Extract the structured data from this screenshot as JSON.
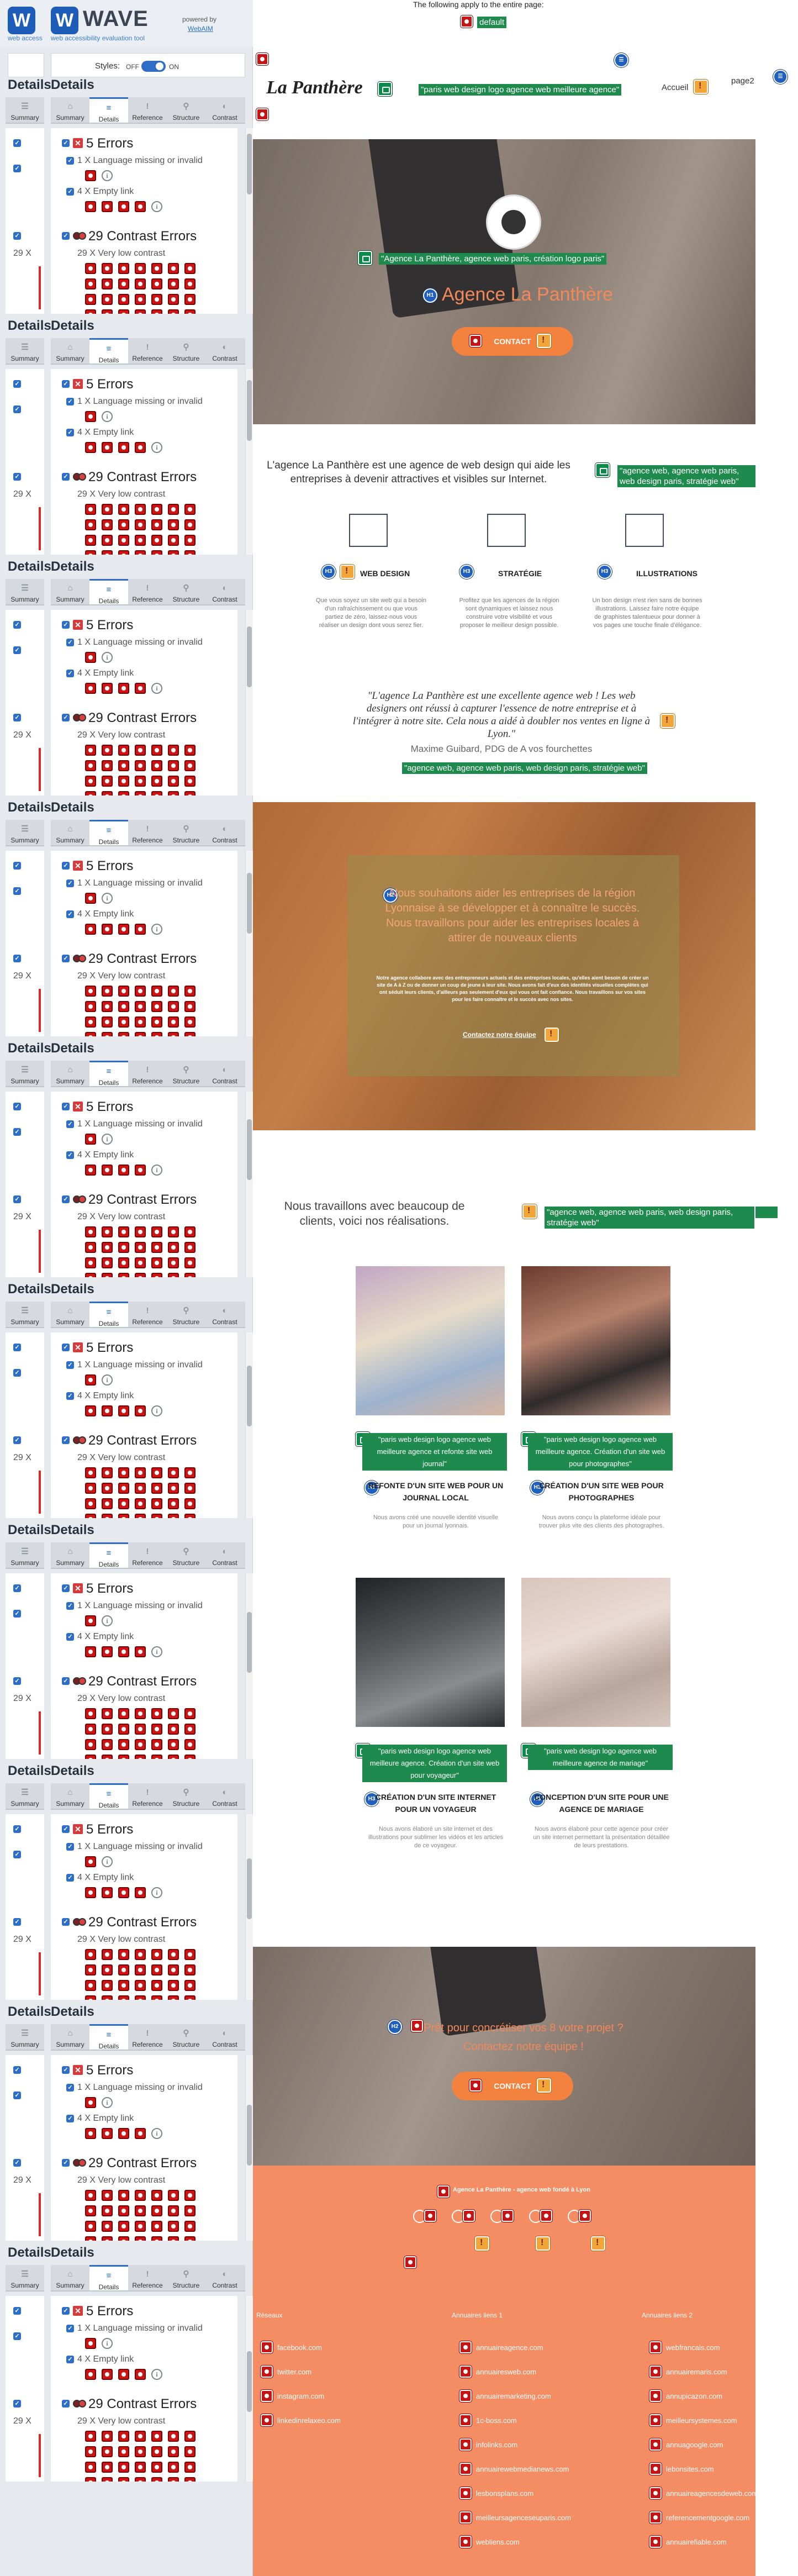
{
  "wave": {
    "brand": "WAVE",
    "sub_left": "web access",
    "sub_right": "web accessibility evaluation tool",
    "powered_by": "powered by",
    "webaim": "WebAIM",
    "styles_label": "Styles:",
    "toggle_off": "OFF",
    "toggle_on": "ON",
    "details_left": "Details",
    "details_right": "Details",
    "tabs": [
      "Summary",
      "Details",
      "Reference",
      "Structure",
      "Contrast"
    ],
    "errors_heading": "5 Errors",
    "lang_missing": "1 X Language missing or invalid",
    "empty_link": "4 X Empty link",
    "contrast_heading": "29 Contrast Errors",
    "very_low_contrast": "29 X Very low contrast",
    "left_count": "29 X"
  },
  "page": {
    "top_note": "The following apply to the entire page:",
    "default_tag": "default",
    "logo_text": "La Panthère",
    "header_tag": "\"paris web design logo agence web meilleure agence\"",
    "nav_home": "Accueil",
    "nav_page2": "page2",
    "hero_tag": "\"Agence La Panthère, agence web paris, création logo paris\"",
    "hero_title": "Agence La Panthère",
    "hero_cta": "CONTACT",
    "intro": "L'agence La Panthère est une agence de web design qui aide les entreprises à devenir attractives et visibles sur Internet.",
    "intro_tag": "\"agence web, agence web paris, web design paris, stratégie web\"",
    "services": [
      {
        "title": "WEB DESIGN",
        "desc": "Que vous soyez un site web qui a besoin d'un rafraîchissement ou que vous partiez de zéro, laissez-nous vous réaliser un design dont vous serez fier."
      },
      {
        "title": "STRATÉGIE",
        "desc": "Profitez que les agences de la région sont dynamiques et laissez nous construire votre visibilité et vous proposer le meilleur design possible."
      },
      {
        "title": "ILLUSTRATIONS",
        "desc": "Un bon design n'est rien sans de bonnes illustrations. Laissez faire notre équipe de graphistes talentueux pour donner à vos pages une touche finale d'élégance."
      }
    ],
    "quote": "\"L'agence La Panthère est une excellente agence web ! Les web designers ont réussi à capturer l'essence de notre entreprise et à l'intégrer à notre site. Cela nous a aidé à doubler nos ventes en ligne à Lyon.\"",
    "quote_author": "Maxime Guibard, PDG de A vos fourchettes",
    "quote_tag": "\"agence web, agence web paris, web design paris, stratégie web\"",
    "mission_title": "Nous souhaitons aider les entreprises de la région Lyonnaise à se développer et à connaître le succès. Nous travaillons pour aider les entreprises locales à attirer de nouveaux clients",
    "mission_body": "Notre agence collabore avec des entrepreneurs actuels et des entreprises locales, qu'elles aient besoin de créer un site de A à Z ou de donner un coup de jeune à leur site. Nous avons fait d'eux des identités visuelles complètes qui ont séduit leurs clients, d'ailleurs pas seulement d'eux qui vous ont fait confiance. Nous travaillons sur vos sites pour les faire connaître et le succès avec nos sites.",
    "mission_link": "Contactez notre équipe",
    "clients_heading": "Nous travaillons avec beaucoup de clients, voici nos réalisations.",
    "clients_tag": "\"agence web, agence web paris, web design paris, stratégie web\"",
    "cards": [
      {
        "tag": "\"paris web design logo agence web meilleure agence et refonte site web journal\"",
        "title": "REFONTE D'UN SITE WEB POUR UN JOURNAL LOCAL",
        "desc": "Nous avons créé une nouvelle identité visuelle pour un journal lyonnais."
      },
      {
        "tag": "\"paris web design logo agence web meilleure agence. Création d'un site web pour photographes\"",
        "title": "CRÉATION D'UN SITE WEB POUR PHOTOGRAPHES",
        "desc": "Nous avons conçu la plateforme idéale pour trouver plus vite des clients des photographes."
      },
      {
        "tag": "\"paris web design logo agence web meilleure agence. Création d'un site web pour voyageur\"",
        "title": "CRÉATION D'UN SITE INTERNET POUR UN VOYAGEUR",
        "desc": "Nous avons élaboré un site internet et des illustrations pour sublimer les vidéos et les articles de ce voyageur."
      },
      {
        "tag": "\"paris web design logo agence web meilleure agence de mariage\"",
        "title": "CONCEPTION D'UN SITE POUR UNE AGENCE DE MARIAGE",
        "desc": "Nous avons élaboré pour cette agence pour créer un site internet permettant la présentation détaillée de leurs prestations."
      }
    ],
    "cta2": "Prêt pour concrétiser vos 8 votre projet ? Contactez notre équipe !",
    "cta2_button": "CONTACT",
    "footer_tag": "Agence La Panthère - agence web fondé à Lyon",
    "footer_heads": [
      "Réseaux",
      "Annuaires liens 1",
      "Annuaires liens 2"
    ],
    "col1": [
      "facebook.com",
      "twitter.com",
      "instagram.com",
      "linkedinrelaxeo.com"
    ],
    "col2": [
      "annuaireagence.com",
      "annuairesweb.com",
      "annuairemarketing.com",
      "1c-boss.com",
      "infolinks.com",
      "annuairewebmedianews.com",
      "lesbonsplans.com",
      "meilleursagenceseuparis.com",
      "webliens.com"
    ],
    "col3": [
      "webfrancais.com",
      "annuairemaris.com",
      "annupicazon.com",
      "meilleursystemes.com",
      "annuagoogle.com",
      "lebonsites.com",
      "annuaireagencesdeweb.com",
      "referencementgoogle.com",
      "annuairefiable.com"
    ]
  }
}
